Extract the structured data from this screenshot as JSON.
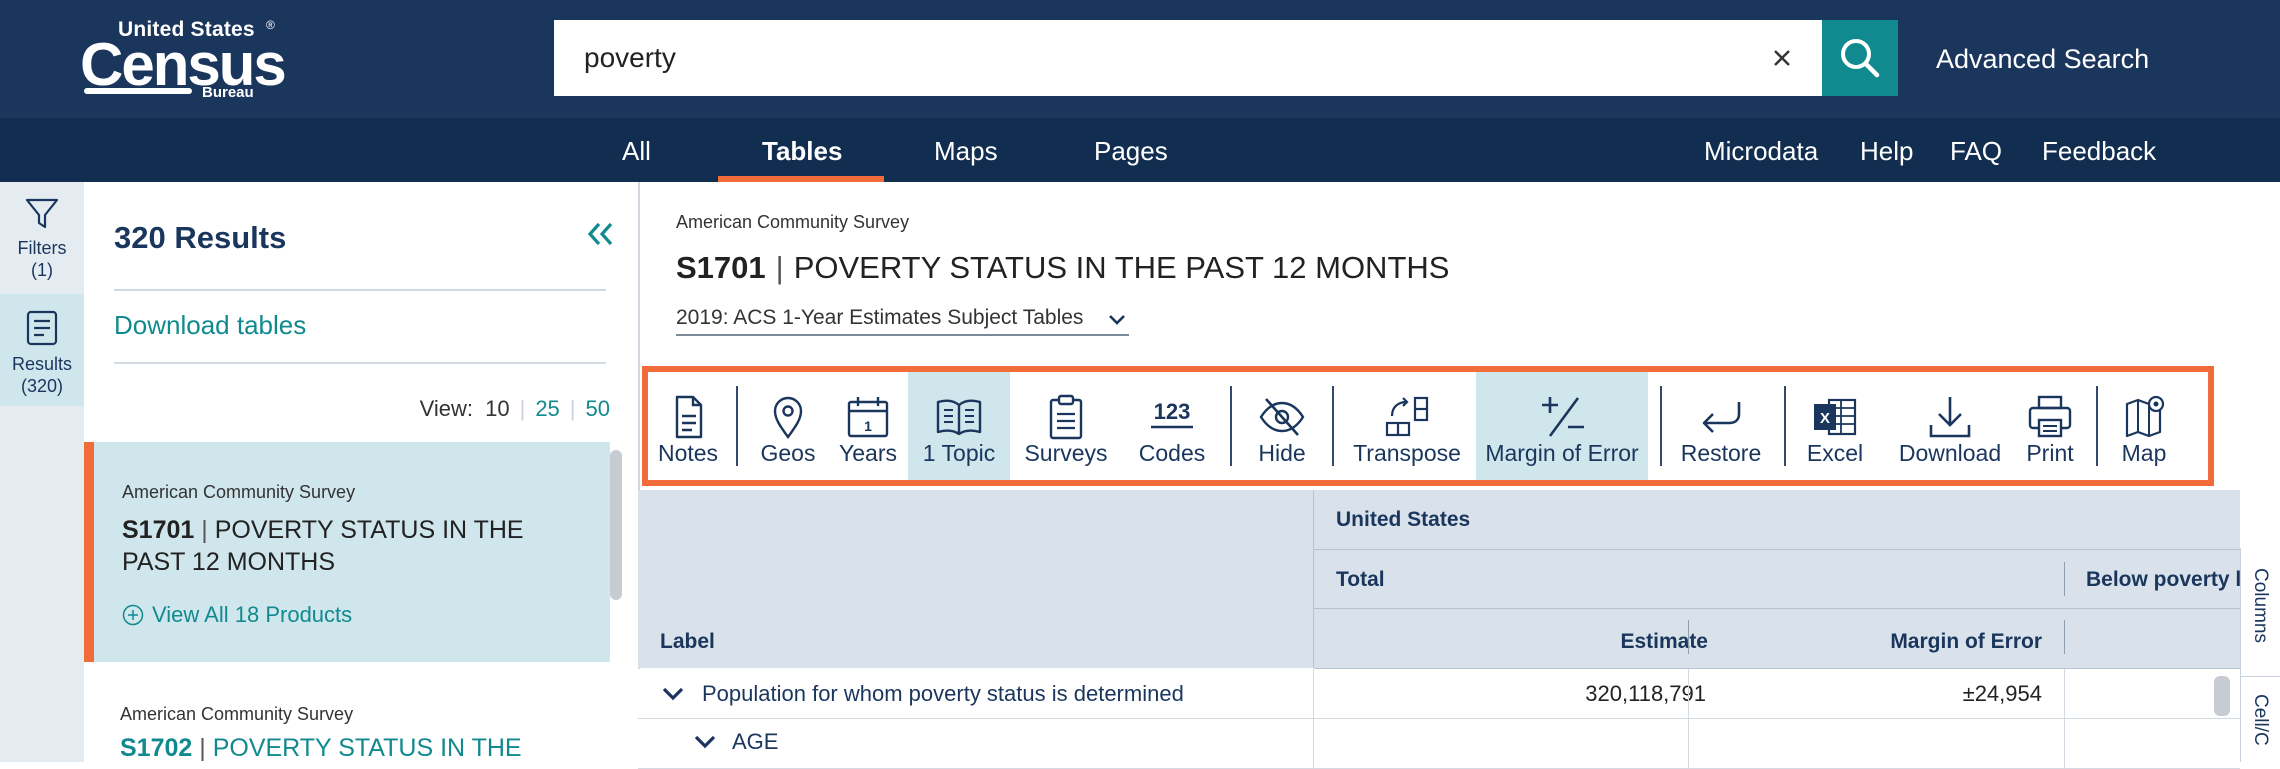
{
  "header": {
    "logo": {
      "top": "United States",
      "reg": "®",
      "main": "Census",
      "bottom": "Bureau"
    },
    "search_value": "poverty",
    "advanced_search": "Advanced Search"
  },
  "nav": {
    "tabs": [
      "All",
      "Tables",
      "Maps",
      "Pages"
    ],
    "active": "Tables",
    "right_links": [
      "Microdata",
      "Help",
      "FAQ",
      "Feedback"
    ]
  },
  "rail": {
    "filters": {
      "label": "Filters",
      "count": "(1)"
    },
    "results": {
      "label": "Results",
      "count": "(320)"
    }
  },
  "results_panel": {
    "count": "320 Results",
    "download_tables": "Download tables",
    "view_label": "View:",
    "view_options": [
      "10",
      "25",
      "50"
    ],
    "items": [
      {
        "source": "American Community Survey",
        "code": "S1701",
        "title": "POVERTY STATUS IN THE PAST 12 MONTHS",
        "view_all": "View All 18 Products"
      },
      {
        "source": "American Community Survey",
        "code": "S1702",
        "title": "POVERTY STATUS IN THE"
      }
    ]
  },
  "table_view": {
    "survey": "American Community Survey",
    "code": "S1701",
    "title": "POVERTY STATUS IN THE PAST 12 MONTHS",
    "vintage": "2019: ACS 1-Year Estimates Subject Tables",
    "toolbar": [
      "Notes",
      "Geos",
      "Years",
      "1 Topic",
      "Surveys",
      "Codes",
      "Hide",
      "Transpose",
      "Margin of Error",
      "Restore",
      "Excel",
      "Download",
      "Print",
      "Map"
    ],
    "active_tools": [
      "1 Topic",
      "Margin of Error"
    ],
    "grid": {
      "geo_header": "United States",
      "group_header": "Total",
      "group_header_2": "Below poverty l",
      "label_header": "Label",
      "col_estimate": "Estimate",
      "col_moe": "Margin of Error",
      "rows": [
        {
          "label": "Population for whom poverty status is determined",
          "estimate": "320,118,791",
          "moe": "±24,954"
        },
        {
          "label": "AGE",
          "estimate": "",
          "moe": ""
        }
      ]
    },
    "side_tabs": [
      "Columns",
      "Cell/C"
    ]
  },
  "colors": {
    "header": "#1a365d",
    "nav": "#112e51",
    "accent": "#f26c3a",
    "teal": "#118a8f",
    "highlight": "#cfe6ec"
  }
}
